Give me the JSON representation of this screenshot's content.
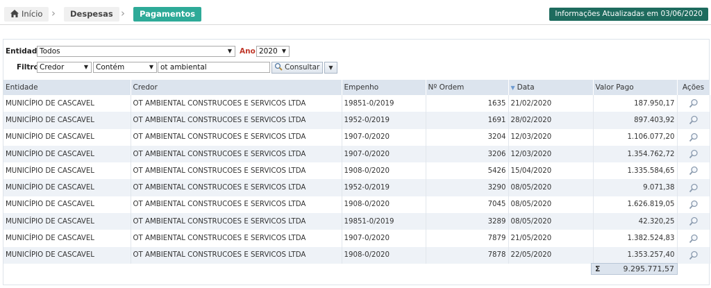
{
  "breadcrumb": {
    "home": "Início",
    "despesas": "Despesas",
    "pagamentos": "Pagamentos"
  },
  "info_badge": "Informações Atualizadas em 03/06/2020",
  "filters": {
    "entidade_label": "Entidade:",
    "entidade_value": "Todos",
    "ano_label": "Ano:",
    "ano_value": "2020",
    "filtro_label": "Filtro:",
    "field_value": "Credor",
    "operator_value": "Contém",
    "search_value": "ot ambiental",
    "consultar_label": "Consultar"
  },
  "table": {
    "headers": {
      "entidade": "Entidade",
      "credor": "Credor",
      "empenho": "Empenho",
      "ordem": "Nº Ordem",
      "data": "Data",
      "valor": "Valor Pago",
      "acoes": "Ações"
    },
    "rows": [
      {
        "entidade": "MUNICÍPIO DE CASCAVEL",
        "credor": "OT AMBIENTAL CONSTRUCOES E SERVICOS LTDA",
        "empenho": "19851-0/2019",
        "ordem": "1635",
        "data": "21/02/2020",
        "valor": "187.950,17"
      },
      {
        "entidade": "MUNICÍPIO DE CASCAVEL",
        "credor": "OT AMBIENTAL CONSTRUCOES E SERVICOS LTDA",
        "empenho": "1952-0/2019",
        "ordem": "1691",
        "data": "28/02/2020",
        "valor": "897.403,92"
      },
      {
        "entidade": "MUNICÍPIO DE CASCAVEL",
        "credor": "OT AMBIENTAL CONSTRUCOES E SERVICOS LTDA",
        "empenho": "1907-0/2020",
        "ordem": "3204",
        "data": "12/03/2020",
        "valor": "1.106.077,20"
      },
      {
        "entidade": "MUNICÍPIO DE CASCAVEL",
        "credor": "OT AMBIENTAL CONSTRUCOES E SERVICOS LTDA",
        "empenho": "1907-0/2020",
        "ordem": "3206",
        "data": "12/03/2020",
        "valor": "1.354.762,72"
      },
      {
        "entidade": "MUNICÍPIO DE CASCAVEL",
        "credor": "OT AMBIENTAL CONSTRUCOES E SERVICOS LTDA",
        "empenho": "1908-0/2020",
        "ordem": "5426",
        "data": "15/04/2020",
        "valor": "1.335.584,65"
      },
      {
        "entidade": "MUNICÍPIO DE CASCAVEL",
        "credor": "OT AMBIENTAL CONSTRUCOES E SERVICOS LTDA",
        "empenho": "1952-0/2019",
        "ordem": "3290",
        "data": "08/05/2020",
        "valor": "9.071,38"
      },
      {
        "entidade": "MUNICÍPIO DE CASCAVEL",
        "credor": "OT AMBIENTAL CONSTRUCOES E SERVICOS LTDA",
        "empenho": "1908-0/2020",
        "ordem": "7045",
        "data": "08/05/2020",
        "valor": "1.626.819,05"
      },
      {
        "entidade": "MUNICÍPIO DE CASCAVEL",
        "credor": "OT AMBIENTAL CONSTRUCOES E SERVICOS LTDA",
        "empenho": "19851-0/2019",
        "ordem": "3289",
        "data": "08/05/2020",
        "valor": "42.320,25"
      },
      {
        "entidade": "MUNICÍPIO DE CASCAVEL",
        "credor": "OT AMBIENTAL CONSTRUCOES E SERVICOS LTDA",
        "empenho": "1907-0/2020",
        "ordem": "7879",
        "data": "21/05/2020",
        "valor": "1.382.524,83"
      },
      {
        "entidade": "MUNICÍPIO DE CASCAVEL",
        "credor": "OT AMBIENTAL CONSTRUCOES E SERVICOS LTDA",
        "empenho": "1908-0/2020",
        "ordem": "7878",
        "data": "22/05/2020",
        "valor": "1.353.257,40"
      }
    ],
    "total_symbol": "Σ",
    "total_value": "9.295.771,57"
  },
  "colors": {
    "accent": "#2eaa98",
    "badge": "#1e6b5e",
    "header_bg": "#dce4ee"
  },
  "icons": {
    "home": "home-icon",
    "chevron": "chevron-right-icon",
    "search": "magnifier-icon",
    "sort": "sort-desc-icon",
    "dropdown": "caret-down-icon"
  }
}
